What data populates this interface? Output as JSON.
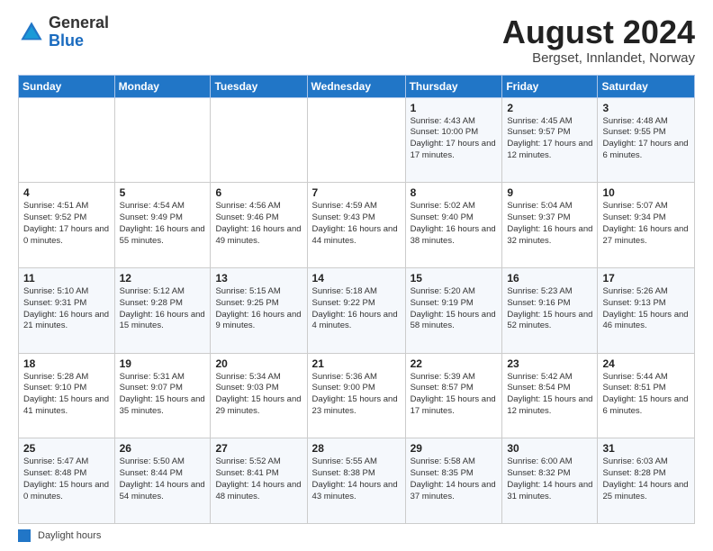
{
  "logo": {
    "general": "General",
    "blue": "Blue"
  },
  "header": {
    "month_year": "August 2024",
    "location": "Bergset, Innlandet, Norway"
  },
  "days_of_week": [
    "Sunday",
    "Monday",
    "Tuesday",
    "Wednesday",
    "Thursday",
    "Friday",
    "Saturday"
  ],
  "weeks": [
    [
      {
        "day": "",
        "info": ""
      },
      {
        "day": "",
        "info": ""
      },
      {
        "day": "",
        "info": ""
      },
      {
        "day": "",
        "info": ""
      },
      {
        "day": "1",
        "info": "Sunrise: 4:43 AM\nSunset: 10:00 PM\nDaylight: 17 hours\nand 17 minutes."
      },
      {
        "day": "2",
        "info": "Sunrise: 4:45 AM\nSunset: 9:57 PM\nDaylight: 17 hours\nand 12 minutes."
      },
      {
        "day": "3",
        "info": "Sunrise: 4:48 AM\nSunset: 9:55 PM\nDaylight: 17 hours\nand 6 minutes."
      }
    ],
    [
      {
        "day": "4",
        "info": "Sunrise: 4:51 AM\nSunset: 9:52 PM\nDaylight: 17 hours\nand 0 minutes."
      },
      {
        "day": "5",
        "info": "Sunrise: 4:54 AM\nSunset: 9:49 PM\nDaylight: 16 hours\nand 55 minutes."
      },
      {
        "day": "6",
        "info": "Sunrise: 4:56 AM\nSunset: 9:46 PM\nDaylight: 16 hours\nand 49 minutes."
      },
      {
        "day": "7",
        "info": "Sunrise: 4:59 AM\nSunset: 9:43 PM\nDaylight: 16 hours\nand 44 minutes."
      },
      {
        "day": "8",
        "info": "Sunrise: 5:02 AM\nSunset: 9:40 PM\nDaylight: 16 hours\nand 38 minutes."
      },
      {
        "day": "9",
        "info": "Sunrise: 5:04 AM\nSunset: 9:37 PM\nDaylight: 16 hours\nand 32 minutes."
      },
      {
        "day": "10",
        "info": "Sunrise: 5:07 AM\nSunset: 9:34 PM\nDaylight: 16 hours\nand 27 minutes."
      }
    ],
    [
      {
        "day": "11",
        "info": "Sunrise: 5:10 AM\nSunset: 9:31 PM\nDaylight: 16 hours\nand 21 minutes."
      },
      {
        "day": "12",
        "info": "Sunrise: 5:12 AM\nSunset: 9:28 PM\nDaylight: 16 hours\nand 15 minutes."
      },
      {
        "day": "13",
        "info": "Sunrise: 5:15 AM\nSunset: 9:25 PM\nDaylight: 16 hours\nand 9 minutes."
      },
      {
        "day": "14",
        "info": "Sunrise: 5:18 AM\nSunset: 9:22 PM\nDaylight: 16 hours\nand 4 minutes."
      },
      {
        "day": "15",
        "info": "Sunrise: 5:20 AM\nSunset: 9:19 PM\nDaylight: 15 hours\nand 58 minutes."
      },
      {
        "day": "16",
        "info": "Sunrise: 5:23 AM\nSunset: 9:16 PM\nDaylight: 15 hours\nand 52 minutes."
      },
      {
        "day": "17",
        "info": "Sunrise: 5:26 AM\nSunset: 9:13 PM\nDaylight: 15 hours\nand 46 minutes."
      }
    ],
    [
      {
        "day": "18",
        "info": "Sunrise: 5:28 AM\nSunset: 9:10 PM\nDaylight: 15 hours\nand 41 minutes."
      },
      {
        "day": "19",
        "info": "Sunrise: 5:31 AM\nSunset: 9:07 PM\nDaylight: 15 hours\nand 35 minutes."
      },
      {
        "day": "20",
        "info": "Sunrise: 5:34 AM\nSunset: 9:03 PM\nDaylight: 15 hours\nand 29 minutes."
      },
      {
        "day": "21",
        "info": "Sunrise: 5:36 AM\nSunset: 9:00 PM\nDaylight: 15 hours\nand 23 minutes."
      },
      {
        "day": "22",
        "info": "Sunrise: 5:39 AM\nSunset: 8:57 PM\nDaylight: 15 hours\nand 17 minutes."
      },
      {
        "day": "23",
        "info": "Sunrise: 5:42 AM\nSunset: 8:54 PM\nDaylight: 15 hours\nand 12 minutes."
      },
      {
        "day": "24",
        "info": "Sunrise: 5:44 AM\nSunset: 8:51 PM\nDaylight: 15 hours\nand 6 minutes."
      }
    ],
    [
      {
        "day": "25",
        "info": "Sunrise: 5:47 AM\nSunset: 8:48 PM\nDaylight: 15 hours\nand 0 minutes."
      },
      {
        "day": "26",
        "info": "Sunrise: 5:50 AM\nSunset: 8:44 PM\nDaylight: 14 hours\nand 54 minutes."
      },
      {
        "day": "27",
        "info": "Sunrise: 5:52 AM\nSunset: 8:41 PM\nDaylight: 14 hours\nand 48 minutes."
      },
      {
        "day": "28",
        "info": "Sunrise: 5:55 AM\nSunset: 8:38 PM\nDaylight: 14 hours\nand 43 minutes."
      },
      {
        "day": "29",
        "info": "Sunrise: 5:58 AM\nSunset: 8:35 PM\nDaylight: 14 hours\nand 37 minutes."
      },
      {
        "day": "30",
        "info": "Sunrise: 6:00 AM\nSunset: 8:32 PM\nDaylight: 14 hours\nand 31 minutes."
      },
      {
        "day": "31",
        "info": "Sunrise: 6:03 AM\nSunset: 8:28 PM\nDaylight: 14 hours\nand 25 minutes."
      }
    ]
  ],
  "footer": {
    "label": "Daylight hours"
  },
  "colors": {
    "header_bg": "#2176c7",
    "accent": "#1a6bbf"
  }
}
